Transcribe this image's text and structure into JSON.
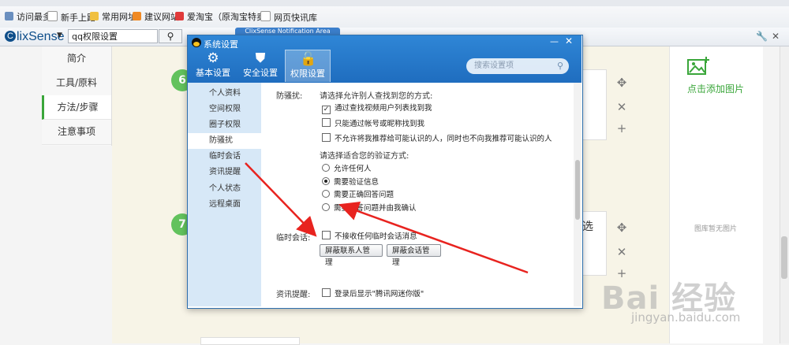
{
  "browser": {
    "favorites": [
      {
        "label": "访问最多",
        "color": "#6a8fbf"
      },
      {
        "label": "新手上路",
        "color": "#dddddd"
      },
      {
        "label": "常用网址",
        "color": "#f0c040"
      },
      {
        "label": "建议网站",
        "color": "#f08a24"
      },
      {
        "label": "爱淘宝（原淘宝特卖）",
        "color": "#e03a3a"
      },
      {
        "label": "网页快讯库",
        "color": "#dddddd"
      }
    ],
    "search": {
      "logo": "ClixSense",
      "logo_rest": "lixSense",
      "logo_initial": "C",
      "query": "qq权限设置",
      "notification_tab": "ClixSense Notification Area"
    }
  },
  "page": {
    "nav": [
      {
        "label": "简介",
        "active": false
      },
      {
        "label": "工具/原料",
        "active": false
      },
      {
        "label": "方法/步骤",
        "active": true
      },
      {
        "label": "注意事项",
        "active": false
      }
    ],
    "steps": [
      "6",
      "7"
    ],
    "partial_text": "选",
    "add_image_label": "点击添加图片",
    "no_image_label": "图库暂无图片",
    "watermark_main": "Bai 经验",
    "watermark_url": "jingyan.baidu.com",
    "accent": "#3aa63a"
  },
  "dialog": {
    "title": "系统设置",
    "tabs": [
      {
        "label": "基本设置",
        "icon": "gear-icon",
        "active": false
      },
      {
        "label": "安全设置",
        "icon": "shield-icon",
        "active": false
      },
      {
        "label": "权限设置",
        "icon": "unlock-icon",
        "active": true
      }
    ],
    "search_placeholder": "搜索设置项",
    "sidebar": [
      {
        "label": "个人资料",
        "active": false
      },
      {
        "label": "空间权限",
        "active": false
      },
      {
        "label": "圈子权限",
        "active": false
      },
      {
        "label": "防骚扰",
        "active": true
      },
      {
        "label": "临时会话",
        "active": false
      },
      {
        "label": "资讯提醒",
        "active": false
      },
      {
        "label": "个人状态",
        "active": false
      },
      {
        "label": "远程桌面",
        "active": false
      }
    ],
    "anti_harass": {
      "label": "防骚扰:",
      "find_prompt": "请选择允许别人查找到您的方式:",
      "find_options": [
        {
          "label": "通过查找视频用户列表找到我",
          "checked": true
        },
        {
          "label": "只能通过帐号或昵称找到我",
          "checked": false
        },
        {
          "label": "不允许将我推荐给可能认识的人，同时也不向我推荐可能认识的人",
          "checked": false
        }
      ],
      "verify_prompt": "请选择适合您的验证方式:",
      "verify_options": [
        {
          "label": "允许任何人",
          "selected": false
        },
        {
          "label": "需要验证信息",
          "selected": true
        },
        {
          "label": "需要正确回答问题",
          "selected": false
        },
        {
          "label": "需要回答问题并由我确认",
          "selected": false
        }
      ]
    },
    "temp_chat": {
      "label": "临时会话:",
      "option": "不接收任何临时会话消息",
      "btn_contacts": "屏蔽联系人管理",
      "btn_sessions": "屏蔽会话管理"
    },
    "news": {
      "label": "资讯提醒:",
      "option": "登录后显示\"腾讯网迷你版\""
    }
  }
}
